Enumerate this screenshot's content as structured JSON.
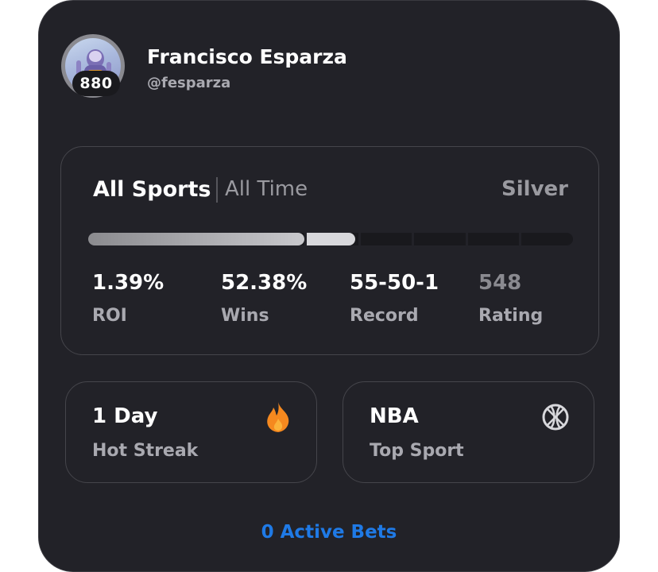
{
  "profile": {
    "name": "Francisco Esparza",
    "handle": "@fesparza",
    "badge_score": "880"
  },
  "stats_panel": {
    "sport_filter": "All Sports",
    "time_filter": "All Time",
    "tier": "Silver",
    "tier_progress_fraction": 0.55,
    "progress_segments": 6,
    "stats": [
      {
        "value": "1.39%",
        "label": "ROI"
      },
      {
        "value": "52.38%",
        "label": "Wins"
      },
      {
        "value": "55-50-1",
        "label": "Record"
      },
      {
        "value": "548",
        "label": "Rating"
      }
    ]
  },
  "tiles": [
    {
      "title": "1 Day",
      "subtitle": "Hot Streak",
      "icon": "fire-icon"
    },
    {
      "title": "NBA",
      "subtitle": "Top Sport",
      "icon": "basketball-icon"
    }
  ],
  "footer": {
    "active_bets_label": "0 Active Bets"
  },
  "colors": {
    "card_bg": "#222228",
    "accent_blue": "#1f7ae6",
    "fire_orange": "#f5891f",
    "muted_text": "#a9a9b0"
  }
}
